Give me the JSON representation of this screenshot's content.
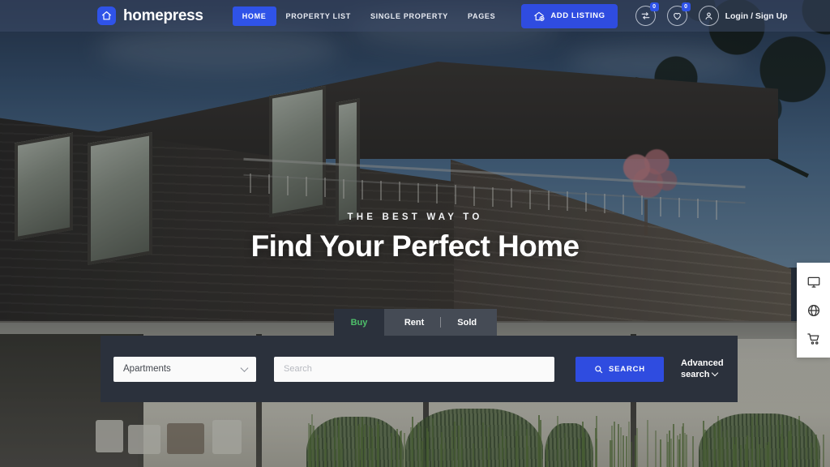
{
  "site": {
    "brand_name": "homepress",
    "brand_icon": "home-icon"
  },
  "header": {
    "nav_items": [
      {
        "label": "HOME",
        "active": true
      },
      {
        "label": "PROPERTY LIST",
        "active": false
      },
      {
        "label": "SINGLE PROPERTY",
        "active": false
      },
      {
        "label": "PAGES",
        "active": false
      }
    ],
    "add_listing_label": "ADD LISTING",
    "add_listing_icon": "home-plus-icon",
    "compare_icon": "compare-arrows-icon",
    "compare_count": "0",
    "favorites_icon": "heart-icon",
    "favorites_count": "0",
    "account_icon": "user-icon",
    "login_label": "Login / Sign Up",
    "accent_color": "#2f4ce0",
    "bar_color": "#3c4a68"
  },
  "hero": {
    "kicker": "THE BEST WAY TO",
    "headline": "Find Your Perfect Home"
  },
  "tabs": {
    "items": [
      {
        "label": "Buy",
        "active": true
      },
      {
        "label": "Rent",
        "active": false
      },
      {
        "label": "Sold",
        "active": false
      }
    ],
    "active_color": "#4ec06a",
    "panel_color": "#2b313c"
  },
  "search": {
    "category_value": "Apartments",
    "category_chevron": "chevron-down-icon",
    "query_value": "",
    "query_placeholder": "Search",
    "search_button_label": "SEARCH",
    "search_button_icon": "search-icon",
    "advanced_line1": "Advanced",
    "advanced_line2": "search",
    "advanced_chevron": "chevron-down-icon"
  },
  "side_panel": {
    "items": [
      {
        "icon": "monitor-icon",
        "name": "desktop-view"
      },
      {
        "icon": "globe-icon",
        "name": "language"
      },
      {
        "icon": "cart-icon",
        "name": "cart"
      }
    ]
  }
}
